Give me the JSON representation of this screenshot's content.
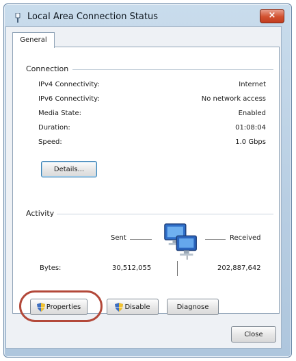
{
  "window": {
    "title": "Local Area Connection Status",
    "close_glyph": "×"
  },
  "tabs": [
    {
      "label": "General",
      "active": true
    }
  ],
  "connection": {
    "heading": "Connection",
    "rows": [
      {
        "label": "IPv4 Connectivity:",
        "value": "Internet"
      },
      {
        "label": "IPv6 Connectivity:",
        "value": "No network access"
      },
      {
        "label": "Media State:",
        "value": "Enabled"
      },
      {
        "label": "Duration:",
        "value": "01:08:04"
      },
      {
        "label": "Speed:",
        "value": "1.0 Gbps"
      }
    ],
    "details_label": "Details..."
  },
  "activity": {
    "heading": "Activity",
    "sent_label": "Sent",
    "received_label": "Received",
    "bytes_label": "Bytes:",
    "bytes_sent": "30,512,055",
    "bytes_received": "202,887,642"
  },
  "actions": {
    "properties_label": "Properties",
    "disable_label": "Disable",
    "diagnose_label": "Diagnose",
    "close_label": "Close"
  },
  "colors": {
    "highlight_ring": "#b3493a",
    "title_bar": "#b7cde2",
    "close_button": "#d2512f"
  },
  "icons": {
    "title": "network-connection-icon",
    "activity": "network-computers-icon",
    "uac": "uac-shield-icon"
  }
}
